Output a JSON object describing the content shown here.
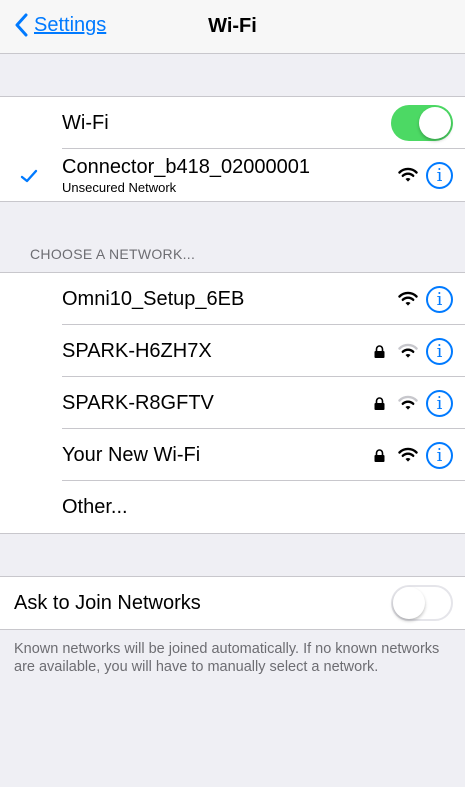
{
  "navbar": {
    "back_label": "Settings",
    "title": "Wi-Fi"
  },
  "wifi_toggle": {
    "label": "Wi-Fi",
    "state": "on"
  },
  "connected": {
    "name": "Connector_b418_02000001",
    "subtitle": "Unsecured Network",
    "icons": [
      "checkmark-icon",
      "wifi-icon",
      "info-icon"
    ]
  },
  "choose_header": "CHOOSE A NETWORK...",
  "networks": [
    {
      "name": "Omni10_Setup_6EB",
      "locked": false,
      "signal": "full"
    },
    {
      "name": "SPARK-H6ZH7X",
      "locked": true,
      "signal": "weak"
    },
    {
      "name": "SPARK-R8GFTV",
      "locked": true,
      "signal": "weak"
    },
    {
      "name": "Your New Wi-Fi",
      "locked": true,
      "signal": "full"
    }
  ],
  "other_label": "Other...",
  "ask_to_join": {
    "label": "Ask to Join Networks",
    "state": "off"
  },
  "footer_text": "Known networks will be joined automatically. If no known networks are available, you will have to manually select a network.",
  "colors": {
    "accent": "#007aff",
    "toggle_on": "#4cd964",
    "background": "#efeff4"
  }
}
